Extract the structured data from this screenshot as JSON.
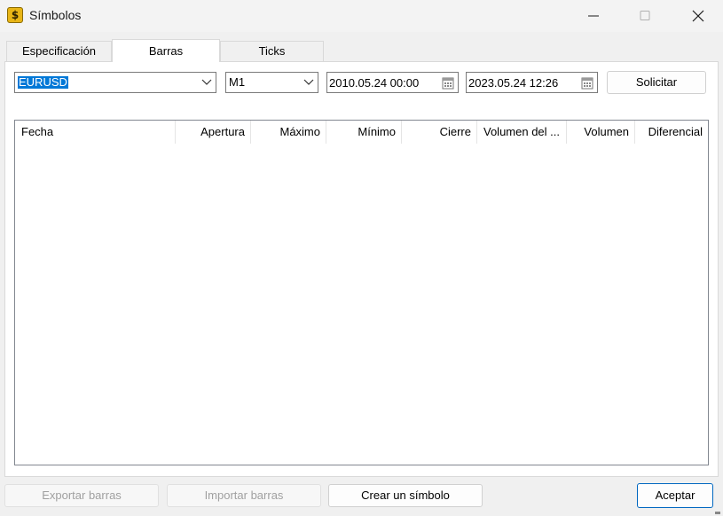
{
  "window": {
    "title": "Símbolos",
    "icon": "dollar-symbol-icon",
    "icon_glyph": "$"
  },
  "tabs": [
    {
      "label": "Especificación",
      "active": false
    },
    {
      "label": "Barras",
      "active": true
    },
    {
      "label": "Ticks",
      "active": false
    }
  ],
  "toolbar": {
    "symbol_value": "EURUSD",
    "timeframe_value": "M1",
    "date_from": "2010.05.24 00:00",
    "date_to": "2023.05.24 12:26",
    "request_label": "Solicitar"
  },
  "table": {
    "columns": [
      "Fecha",
      "Apertura",
      "Máximo",
      "Mínimo",
      "Cierre",
      "Volumen del ...",
      "Volumen",
      "Diferencial"
    ],
    "rows": []
  },
  "footer": {
    "export_label": "Exportar barras",
    "import_label": "Importar barras",
    "create_label": "Crear un símbolo",
    "accept_label": "Aceptar"
  },
  "colors": {
    "selection": "#0078d7",
    "accent_border": "#0067c0",
    "icon_gold": "#e8b516"
  }
}
